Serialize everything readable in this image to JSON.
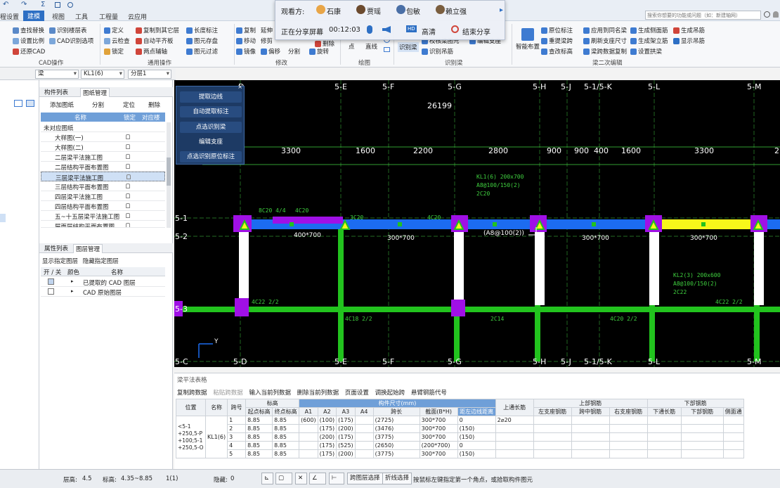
{
  "quick_access": {
    "undo": "↶",
    "redo": "↷",
    "sum": "Σ"
  },
  "menu": [
    {
      "label": "程设置",
      "active": false
    },
    {
      "label": "建模",
      "active": true
    },
    {
      "label": "视图",
      "active": false
    },
    {
      "label": "工具",
      "active": false
    },
    {
      "label": "工程量",
      "active": false
    },
    {
      "label": "云应用",
      "active": false
    }
  ],
  "search_placeholder": "搜索你想要的功能或问题（如：新建轴网）",
  "share": {
    "viewers_label": "观看方:",
    "viewers": [
      "石康",
      "贾瑶",
      "包敏",
      "赖立强"
    ],
    "status": "正在分享屏幕",
    "time": "00:12:03",
    "quality": "高清",
    "end": "结束分享"
  },
  "ribbon": {
    "cad": {
      "items": [
        "查找替换",
        "识别楼层表",
        "设置比例",
        "CAD识别选项",
        "还原CAD"
      ],
      "label": "CAD操作"
    },
    "general": {
      "items": [
        "定义",
        "复制到其它层",
        "长度标注",
        "云检查",
        "自动平齐板",
        "图元存盘",
        "锁定",
        "两点辅轴",
        "图元过滤"
      ],
      "label": "通用操作"
    },
    "modify": {
      "items": [
        "复制",
        "延伸",
        "移动",
        "修剪",
        "打断",
        "镜像",
        "偏移",
        "分割",
        "删除",
        "旋转"
      ],
      "label": "修改"
    },
    "draw": {
      "items": [
        "点",
        "直线"
      ],
      "label": "绘图"
    },
    "recog": {
      "items": [
        "识别梁",
        "校核梁图元",
        "识别吊筋",
        "编辑支座"
      ],
      "label": "识别梁"
    },
    "beam2": {
      "items": [
        "智能布置",
        "原位标注",
        "应用到同名梁",
        "生成侧面筋",
        "生成吊筋",
        "重提梁跨",
        "刷新支座尺寸",
        "生成架立筋",
        "显示吊筋",
        "查改标高",
        "梁跨数据复制",
        "设置拱梁"
      ],
      "label": "梁二次编辑"
    }
  },
  "dropbar": {
    "cat": "梁",
    "comp": "KL1(6)",
    "layer": "分层1"
  },
  "comp_panel": {
    "tabs": [
      "构件列表",
      "图纸管理"
    ],
    "toolbar": [
      "添加图纸",
      "分割",
      "定位",
      "删除"
    ],
    "headers": [
      "名称",
      "锁定",
      "对应楼层"
    ],
    "group": "未对应图纸",
    "drawings": [
      "大样图(一)",
      "大样图(二)",
      "二层梁平法施工图",
      "二层结构平面布置图",
      "三层梁平法施工图",
      "三层结构平面布置图",
      "四层梁平法施工图",
      "四层结构平面布置图",
      "五~十五层梁平法施工图",
      "屋面层结构平面布置图"
    ],
    "selected_index": 4
  },
  "layer_panel": {
    "tabs": [
      "属性列表",
      "图层管理"
    ],
    "toolbar": [
      "显示指定图层",
      "隐藏指定图层"
    ],
    "headers": [
      "开 / 关",
      "颜色",
      "名称"
    ],
    "rows": [
      "已提取的 CAD 图层",
      "CAD 原始图层"
    ]
  },
  "float_menu": [
    "提取边线",
    "自动提取标注",
    "点选识别梁",
    "编辑支座",
    "点选识别原位标注"
  ],
  "cad": {
    "top_axes": [
      "D",
      "5-E",
      "5-F",
      "5-G",
      "5-H",
      "5-J",
      "5-1/5-K",
      "5-L",
      "5-M"
    ],
    "bottom_axes": [
      "5-D",
      "5-E",
      "5-F",
      "5-G",
      "5-H",
      "5-J",
      "5-1/5-K",
      "5-L",
      "5-M"
    ],
    "side_axes": [
      "5-1",
      "5-2",
      "5-3",
      "5-C"
    ],
    "total_dim": "26199",
    "dims": [
      "3300",
      "1600",
      "2200",
      "2800",
      "900",
      "900",
      "400",
      "1600",
      "3300",
      "2"
    ],
    "labels": [
      "400*700",
      "300*700",
      "(A8@100(2))",
      "300*700",
      "300*700",
      "KL1(6) 200x700",
      "A8@100/150(2)",
      "2C20",
      "4C20",
      "4C20",
      "3C20",
      "8C20 4/4",
      "4C22 2/2",
      "4C18 2/2",
      "2C14",
      "4C20 2/2",
      "4C22 2/2",
      "KL2(3) 200x600",
      "A8@100/150(2)",
      "2C22"
    ],
    "coord_label": "Y"
  },
  "table": {
    "title": "梁平法表格",
    "tools": [
      "复制跨数据",
      "粘贴跨数据",
      "输入当前列数据",
      "删除当前列数据",
      "页面设置",
      "调换起始跨",
      "悬臂钢筋代号"
    ],
    "group_headers": [
      "标高",
      "构件尺寸(mm)",
      "上部钢筋",
      "下部钢筋"
    ],
    "headers": [
      "位置",
      "名称",
      "跨号",
      "起点标高",
      "终点标高",
      "A1",
      "A2",
      "A3",
      "A4",
      "跨长",
      "截面(B*H)",
      "距左边线距离",
      "上通长筋",
      "左支座钢筋",
      "跨中钢筋",
      "右支座钢筋",
      "下通长筋",
      "下部钢筋",
      "侧面通"
    ],
    "position": "<5-1 +250,5-P +100;5-1 +250,5-O",
    "name": "KL1(6)",
    "rows": [
      [
        "1",
        "8.85",
        "8.85",
        "(600)",
        "(100)",
        "(175)",
        "",
        "(2725)",
        "300*700",
        "0",
        "2⌀20"
      ],
      [
        "2",
        "8.85",
        "8.85",
        "",
        "(175)",
        "(200)",
        "",
        "(3476)",
        "300*700",
        "(150)",
        ""
      ],
      [
        "3",
        "8.85",
        "8.85",
        "",
        "(200)",
        "(175)",
        "",
        "(3775)",
        "300*700",
        "(150)",
        ""
      ],
      [
        "4",
        "8.85",
        "8.85",
        "",
        "(175)",
        "(525)",
        "",
        "(2650)",
        "(200*700)",
        "0",
        ""
      ],
      [
        "5",
        "8.85",
        "8.85",
        "",
        "(175)",
        "(200)",
        "",
        "(3775)",
        "300*700",
        "(150)",
        ""
      ]
    ]
  },
  "status": {
    "floor_h_label": "层高:",
    "floor_h": "4.5",
    "elev_label": "标高:",
    "elev": "4.35~8.85",
    "count": "1(1)",
    "hidden_label": "隐藏:",
    "hidden": "0",
    "btn1": "跨图层选择",
    "btn2": "折线选择",
    "hint": "按鼠标左键指定第一个角点，或拾取构件图元"
  },
  "colors": {
    "beam_blue": "#1c6cf0",
    "column_purple": "#a010e6",
    "beam_green": "#22c31e",
    "beam_yellow": "#f7f71a",
    "axis_green": "#3fd03f",
    "accent": "#2d6fc4"
  }
}
